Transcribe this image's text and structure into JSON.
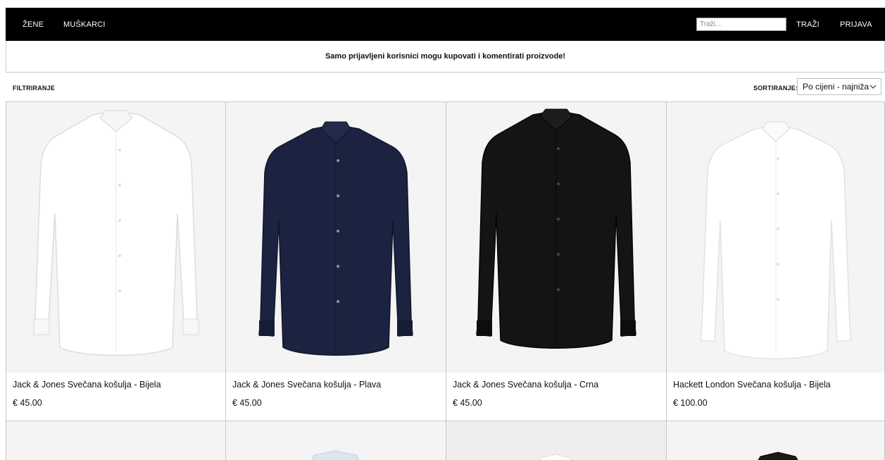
{
  "nav": {
    "women": "ŽENE",
    "men": "MUŠKARCI",
    "search_placeholder": "Traži...",
    "search_button": "TRAŽI",
    "login": "PRIJAVA"
  },
  "notice": "Samo prijavljeni korisnici mogu kupovati i komentirati proizvode!",
  "toolbar": {
    "filter_label": "FILTRIRANJE",
    "sort_label": "SORTIRANJE:",
    "sort_value": "Po cijeni - najniža"
  },
  "products": [
    {
      "name": "Jack & Jones Svečana košulja - Bijela",
      "price": "€ 45.00",
      "color": "#fafafa"
    },
    {
      "name": "Jack & Jones Svečana košulja - Plava",
      "price": "€ 45.00",
      "color": "#1c2340"
    },
    {
      "name": "Jack & Jones Svečana košulja - Crna",
      "price": "€ 45.00",
      "color": "#141414"
    },
    {
      "name": "Hackett London Svečana košulja - Bijela",
      "price": "€ 100.00",
      "color": "#fdfdfd"
    }
  ],
  "products_row2_colors": [
    "#f4f4f4",
    "#dbe6ef",
    "#f2f2f2",
    "#1a1a1a"
  ]
}
